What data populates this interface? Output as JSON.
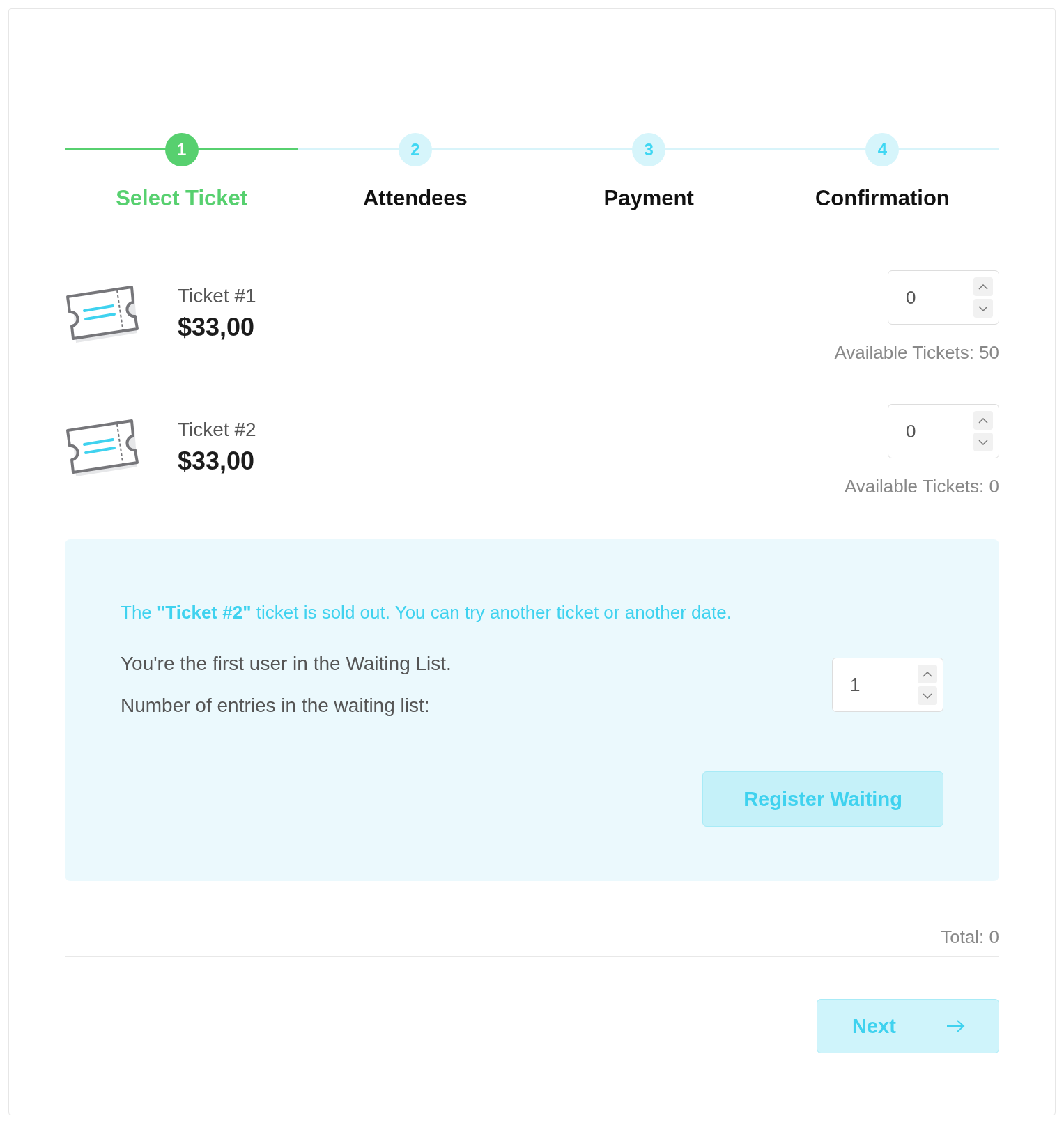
{
  "steps": [
    {
      "number": "1",
      "label": "Select Ticket",
      "selected": true
    },
    {
      "number": "2",
      "label": "Attendees",
      "selected": false
    },
    {
      "number": "3",
      "label": "Payment",
      "selected": false
    },
    {
      "number": "4",
      "label": "Confirmation",
      "selected": false
    }
  ],
  "tickets": [
    {
      "name": "Ticket #1",
      "price": "$33,00",
      "quantity": "0",
      "available": "Available Tickets: 50"
    },
    {
      "name": "Ticket #2",
      "price": "$33,00",
      "quantity": "0",
      "available": "Available Tickets: 0"
    }
  ],
  "waiting_list": {
    "notice": "The **\"Ticket #2\"** ticket is sold out. You can try another ticket or another date.",
    "position": "You're the first user in the Waiting List.",
    "entries_label": "Number of entries in the waiting list:",
    "entries": "1",
    "button": "Register Waiting"
  },
  "total": "Total: 0",
  "next_button": "Next"
}
